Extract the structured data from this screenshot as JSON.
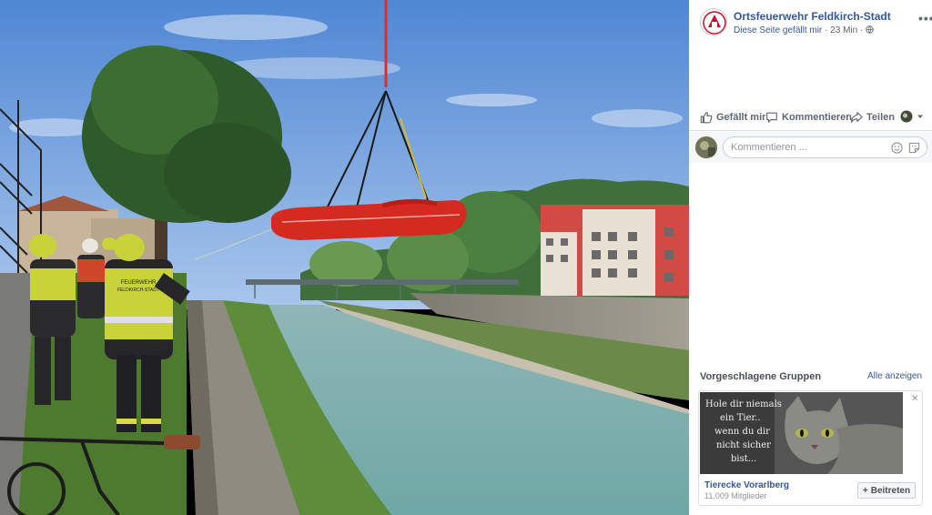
{
  "post": {
    "page_name": "Ortsfeuerwehr Feldkirch-Stadt",
    "liked_text": "Diese Seite gefällt mir",
    "separator": "·",
    "time": "23 Min",
    "privacy_icon": "globe-icon",
    "more_label": "•••"
  },
  "actions": {
    "like": "Gefällt mir",
    "comment": "Kommentieren",
    "share": "Teilen"
  },
  "comment_box": {
    "placeholder": "Kommentieren ..."
  },
  "suggested_groups": {
    "title": "Vorgeschlagene Gruppen",
    "see_all": "Alle anzeigen",
    "group": {
      "image_text_lines": [
        "Hole dir niemals",
        "ein Tier..",
        "wenn du dir",
        "nicht sicher",
        "bist..."
      ],
      "name": "Tierecke Vorarlberg",
      "members": "11.009 Mitglieder",
      "join_label": "Beitreten",
      "close_label": "✕"
    }
  },
  "photo": {
    "vest_text_lines": [
      "FEUERWEHR",
      "FELDKIRCH-STADT"
    ]
  },
  "colors": {
    "link": "#365899",
    "brand_red": "#c8102e",
    "sky": "#5d90d6"
  }
}
